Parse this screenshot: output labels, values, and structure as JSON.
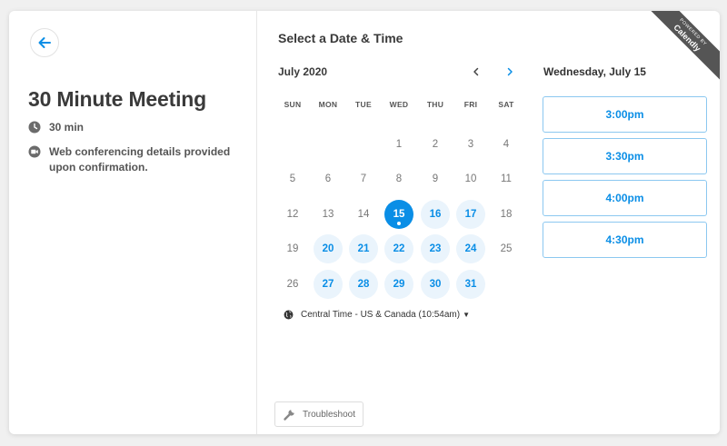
{
  "event": {
    "title": "30 Minute Meeting",
    "duration": "30 min",
    "conferencing": "Web conferencing details provided upon confirmation."
  },
  "scheduler": {
    "heading": "Select a Date & Time",
    "month": "July 2020",
    "weekdays": [
      "SUN",
      "MON",
      "TUE",
      "WED",
      "THU",
      "FRI",
      "SAT"
    ],
    "start_weekday_index": 3,
    "days_in_month": 31,
    "available_days": [
      15,
      16,
      17,
      20,
      21,
      22,
      23,
      24,
      27,
      28,
      29,
      30,
      31
    ],
    "selected_day": 15,
    "timezone": "Central Time - US & Canada (10:54am)",
    "selected_date_label": "Wednesday, July 15",
    "time_slots": [
      "3:00pm",
      "3:30pm",
      "4:00pm",
      "4:30pm"
    ]
  },
  "footer": {
    "troubleshoot_label": "Troubleshoot"
  },
  "badge": {
    "powered_by": "POWERED BY",
    "brand": "Calendly"
  },
  "colors": {
    "accent": "#0a8ee6",
    "available_bg": "#eaf4fc",
    "ribbon": "#555555"
  },
  "icons": {
    "back": "arrow-left-icon",
    "duration": "clock-icon",
    "conferencing": "video-camera-icon",
    "prev_month": "chevron-left-icon",
    "next_month": "chevron-right-icon",
    "timezone": "globe-icon",
    "troubleshoot": "wrench-icon"
  }
}
